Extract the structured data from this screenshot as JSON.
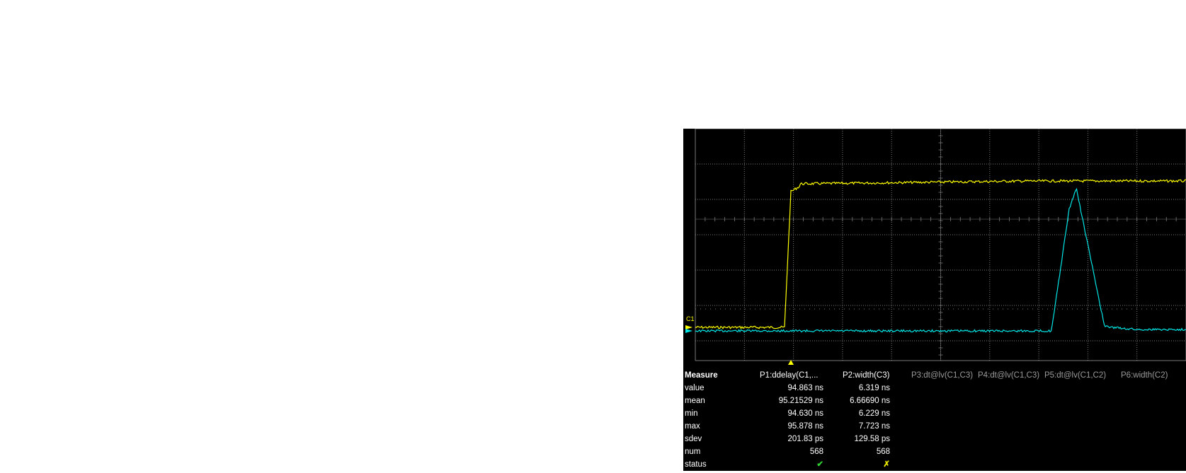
{
  "scope": {
    "channel_label": "C1",
    "trace_colors": {
      "C1": "#ffff00",
      "C3": "#00e5e5"
    },
    "grid_color": "#7a7a7a"
  },
  "measure": {
    "header": "Measure",
    "columns": [
      {
        "label": "P1:ddelay(C1,...",
        "active": true
      },
      {
        "label": "P2:width(C3)",
        "active": true
      },
      {
        "label": "P3:dt@lv(C1,C3)",
        "active": false
      },
      {
        "label": "P4:dt@lv(C1,C3)",
        "active": false
      },
      {
        "label": "P5:dt@lv(C1,C2)",
        "active": false
      },
      {
        "label": "P6:width(C2)",
        "active": false
      }
    ],
    "rows": [
      {
        "label": "value",
        "p1": "94.863 ns",
        "p2": "6.319 ns"
      },
      {
        "label": "mean",
        "p1": "95.21529 ns",
        "p2": "6.66690 ns"
      },
      {
        "label": "min",
        "p1": "94.630 ns",
        "p2": "6.229 ns"
      },
      {
        "label": "max",
        "p1": "95.878 ns",
        "p2": "7.723 ns"
      },
      {
        "label": "sdev",
        "p1": "201.83 ps",
        "p2": "129.58 ps"
      },
      {
        "label": "num",
        "p1": "568",
        "p2": "568"
      },
      {
        "label": "status",
        "p1": "✔",
        "p2": "✗"
      }
    ]
  }
}
